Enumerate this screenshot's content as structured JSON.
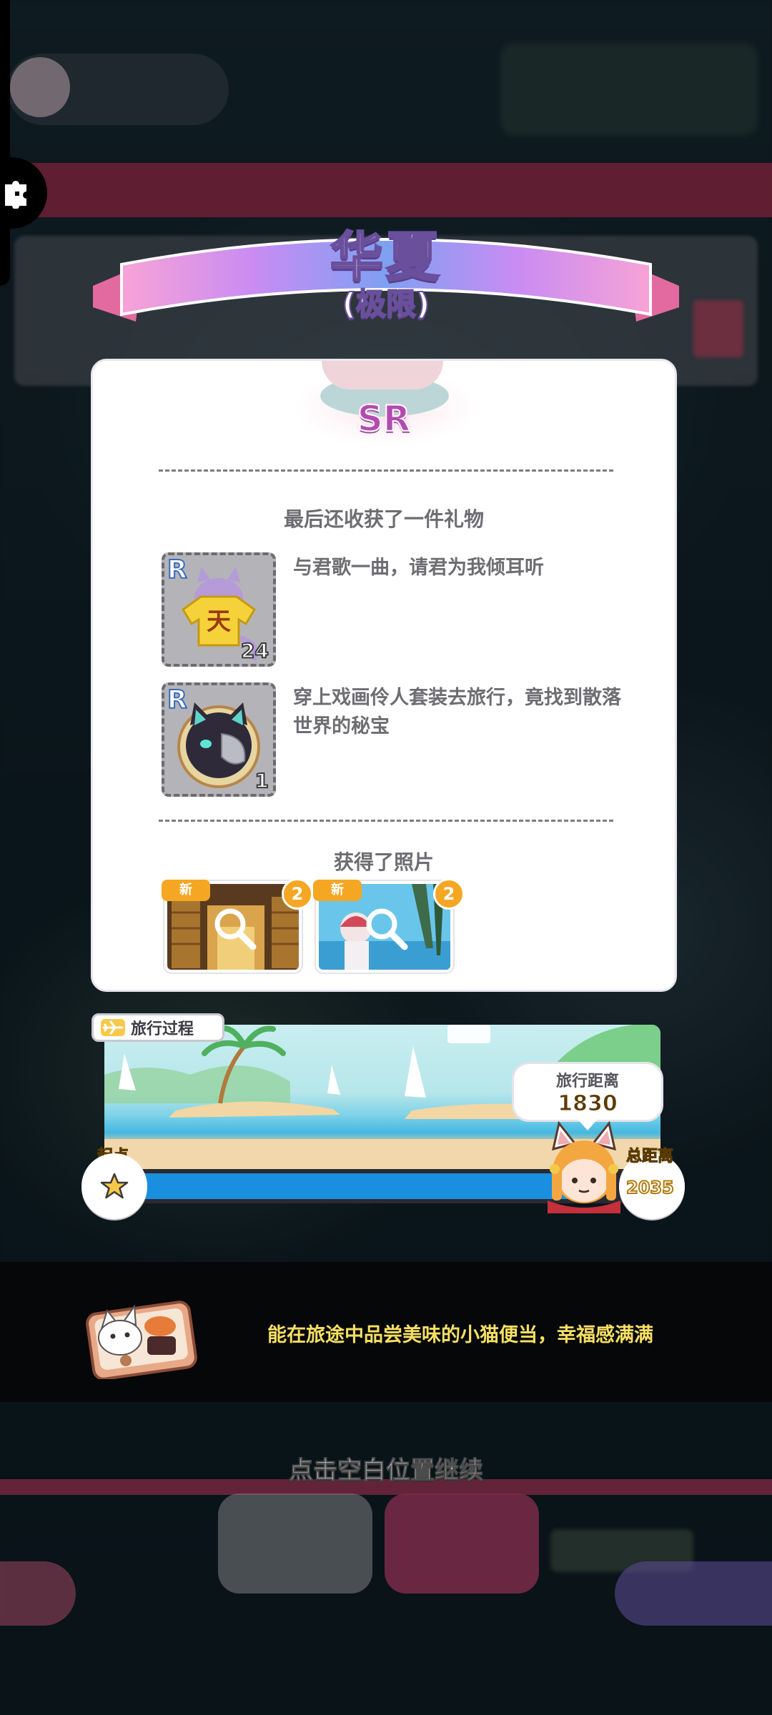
{
  "header": {
    "title": "华夏",
    "subtitle": "(极限)"
  },
  "rarity": "SR",
  "gifts": {
    "section_title": "最后还收获了一件礼物",
    "items": [
      {
        "rarity": "R",
        "count": "24",
        "description": "与君歌一曲，请君为我倾耳听"
      },
      {
        "rarity": "R",
        "count": "1",
        "description": "穿上戏画伶人套装去旅行，竟找到散落世界的秘宝"
      }
    ]
  },
  "photos": {
    "section_title": "获得了照片",
    "items": [
      {
        "badge": "新",
        "count": "2"
      },
      {
        "badge": "新",
        "count": "2"
      }
    ]
  },
  "travel": {
    "tag": "旅行过程",
    "start_label": "起点",
    "end_label": "总距离",
    "distance_label": "旅行距离",
    "distance_value": "1830",
    "total_distance": "2035",
    "progress": 0.899
  },
  "message": "能在旅途中品尝美味的小猫便当，幸福感满满",
  "continue_hint": "点击空白位置继续",
  "colors": {
    "panel": "#ffffff",
    "accent_gold": "#f5a623",
    "progress_blue": "#1a8fdf",
    "message_yellow": "#f6df63"
  }
}
